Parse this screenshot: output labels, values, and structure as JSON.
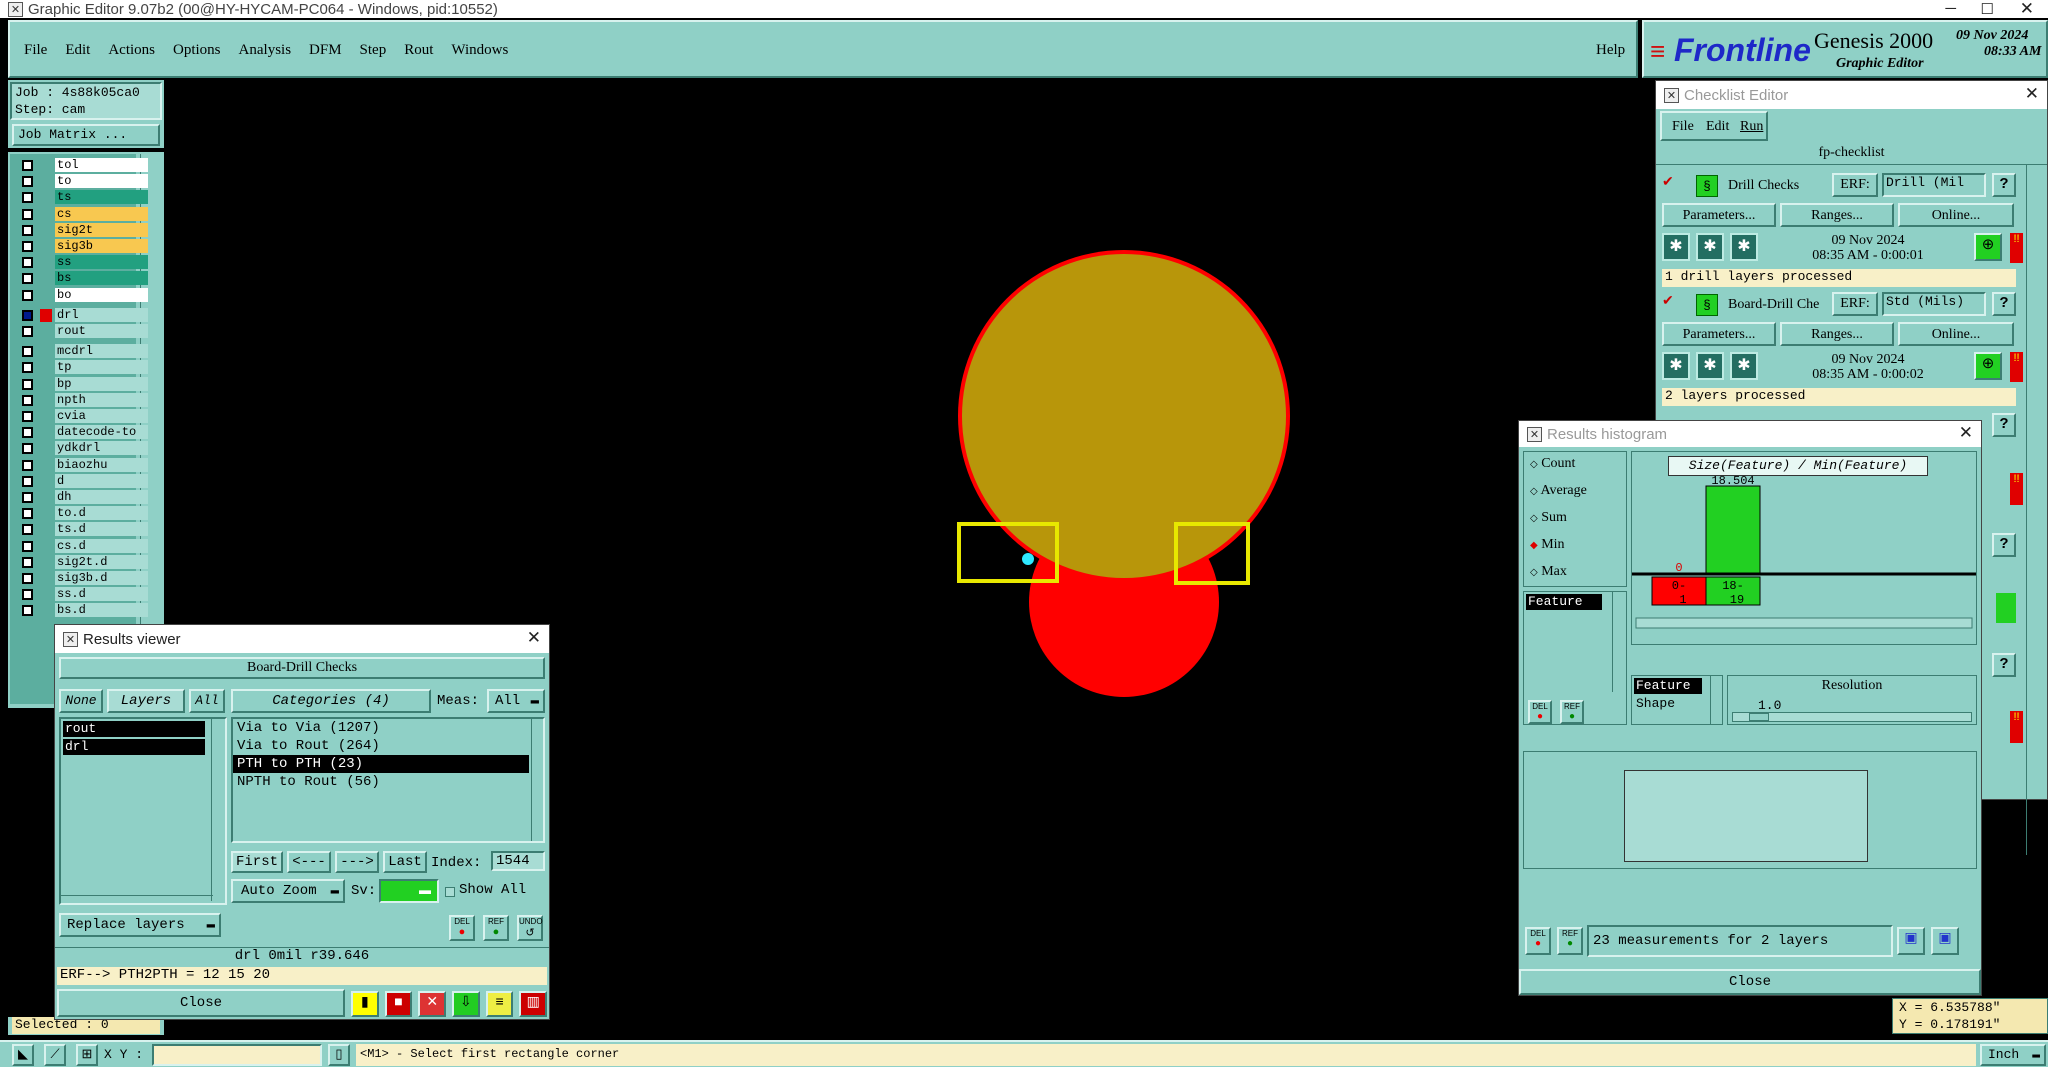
{
  "window": {
    "title": "Graphic Editor 9.07b2 (00@HY-HYCAM-PC064 - Windows, pid:10552)"
  },
  "menubar": {
    "items": [
      "File",
      "Edit",
      "Actions",
      "Options",
      "Analysis",
      "DFM",
      "Step",
      "Rout",
      "Windows"
    ],
    "help": "Help"
  },
  "brand": {
    "logo": "Frontline",
    "product": "Genesis 2000",
    "subtitle": "Graphic Editor",
    "date": "09 Nov 2024",
    "time": "08:33 AM"
  },
  "job": {
    "job_label": "Job : 4s88k05ca0",
    "step_label": "Step: cam",
    "matrix_button": "Job Matrix ..."
  },
  "layers": [
    {
      "name": "tol",
      "color": "#ffffff"
    },
    {
      "name": "to",
      "color": "#ffffff"
    },
    {
      "name": "ts",
      "color": "#22a080"
    },
    {
      "name": "cs",
      "color": "#f8c850"
    },
    {
      "name": "sig2t",
      "color": "#f8c850"
    },
    {
      "name": "sig3b",
      "color": "#f8c850"
    },
    {
      "name": "ss",
      "color": "#22a080"
    },
    {
      "name": "bs",
      "color": "#22a080"
    },
    {
      "name": "bo",
      "color": "#ffffff"
    },
    {
      "name": "drl",
      "color": "#a8dcd4"
    },
    {
      "name": "rout",
      "color": "#a8dcd4"
    },
    {
      "name": "mcdrl",
      "color": "#a8dcd4"
    },
    {
      "name": "tp",
      "color": "#a8dcd4"
    },
    {
      "name": "bp",
      "color": "#a8dcd4"
    },
    {
      "name": "npth",
      "color": "#a8dcd4"
    },
    {
      "name": "cvia",
      "color": "#a8dcd4"
    },
    {
      "name": "datecode-to",
      "color": "#a8dcd4"
    },
    {
      "name": "ydkdrl",
      "color": "#a8dcd4"
    },
    {
      "name": "biaozhu",
      "color": "#a8dcd4"
    },
    {
      "name": "d",
      "color": "#a8dcd4"
    },
    {
      "name": "dh",
      "color": "#a8dcd4"
    },
    {
      "name": "to.d",
      "color": "#a8dcd4"
    },
    {
      "name": "ts.d",
      "color": "#a8dcd4"
    },
    {
      "name": "cs.d",
      "color": "#a8dcd4"
    },
    {
      "name": "sig2t.d",
      "color": "#a8dcd4"
    },
    {
      "name": "sig3b.d",
      "color": "#a8dcd4"
    },
    {
      "name": "ss.d",
      "color": "#a8dcd4"
    },
    {
      "name": "bs.d",
      "color": "#a8dcd4"
    }
  ],
  "selected": "Selected : 0",
  "statusbar": {
    "xy_label": "X Y :",
    "message": "<M1> - Select first rectangle corner",
    "units": "Inch"
  },
  "coords": {
    "x": "X = 6.535788\"",
    "y": "Y = 0.178191\""
  },
  "results_viewer": {
    "title": "Results viewer",
    "check_name": "Board-Drill Checks",
    "tab_none": "None",
    "tab_layers": "Layers",
    "tab_all": "All",
    "categories_btn": "Categories (4)",
    "meas_label": "Meas:",
    "meas_value": "All",
    "layer_list": [
      "rout",
      "drl"
    ],
    "categories": [
      "Via to Via  (1207)",
      "Via to Rout  (264)",
      "PTH to PTH  (23)",
      "NPTH to Rout  (56)"
    ],
    "nav": {
      "first": "First",
      "prev": "<---",
      "next": "--->",
      "last": "Last",
      "index_label": "Index:",
      "index_value": "1544"
    },
    "auto_zoom": "Auto Zoom",
    "sv_label": "Sv:",
    "show_all": "Show All",
    "replace_layers": "Replace layers",
    "info_line": "drl  0mil  r39.646",
    "erf_line": "ERF--> PTH2PTH = 12 15 20",
    "close": "Close",
    "del": "DEL",
    "ref": "REF",
    "undo": "UNDO"
  },
  "checklist": {
    "title": "Checklist Editor",
    "menu": [
      "File",
      "Edit",
      "Run"
    ],
    "name": "fp-checklist",
    "checks": [
      {
        "name": "Drill Checks",
        "erf_label": "ERF:",
        "erf_value": "Drill (Mil",
        "params": "Parameters...",
        "ranges": "Ranges...",
        "online": "Online...",
        "date": "09 Nov 2024",
        "time": "08:35 AM - 0:00:01",
        "status": "1 drill layers processed"
      },
      {
        "name": "Board-Drill Che",
        "erf_label": "ERF:",
        "erf_value": "Std (Mils)",
        "params": "Parameters...",
        "ranges": "Ranges...",
        "online": "Online...",
        "date": "09 Nov 2024",
        "time": "08:35 AM - 0:00:02",
        "status": "2 layers processed"
      }
    ]
  },
  "histogram": {
    "title": "Results histogram",
    "modes": [
      "Count",
      "Average",
      "Sum",
      "Min",
      "Max"
    ],
    "selected_mode": "Min",
    "feature_label": "Feature",
    "chart_title": "Size(Feature) / Min(Feature)",
    "shape_options": [
      "Feature",
      "Shape"
    ],
    "resolution_label": "Resolution",
    "resolution_value": "1.0",
    "summary": "23 measurements for 2 layers",
    "close": "Close",
    "del": "DEL",
    "ref": "REF"
  },
  "chart_data": {
    "type": "bar",
    "title": "Size(Feature) / Min(Feature)",
    "categories": [
      "0-1",
      "18-19"
    ],
    "values": [
      0,
      18.504
    ],
    "data_labels": [
      "0",
      "18.504"
    ]
  },
  "colors": {
    "panel": "#8fd0c6",
    "accent_green": "#22d022",
    "pad_gold": "#b8960a",
    "pad_red": "#ff0000",
    "highlight_yellow": "#e8e800"
  }
}
